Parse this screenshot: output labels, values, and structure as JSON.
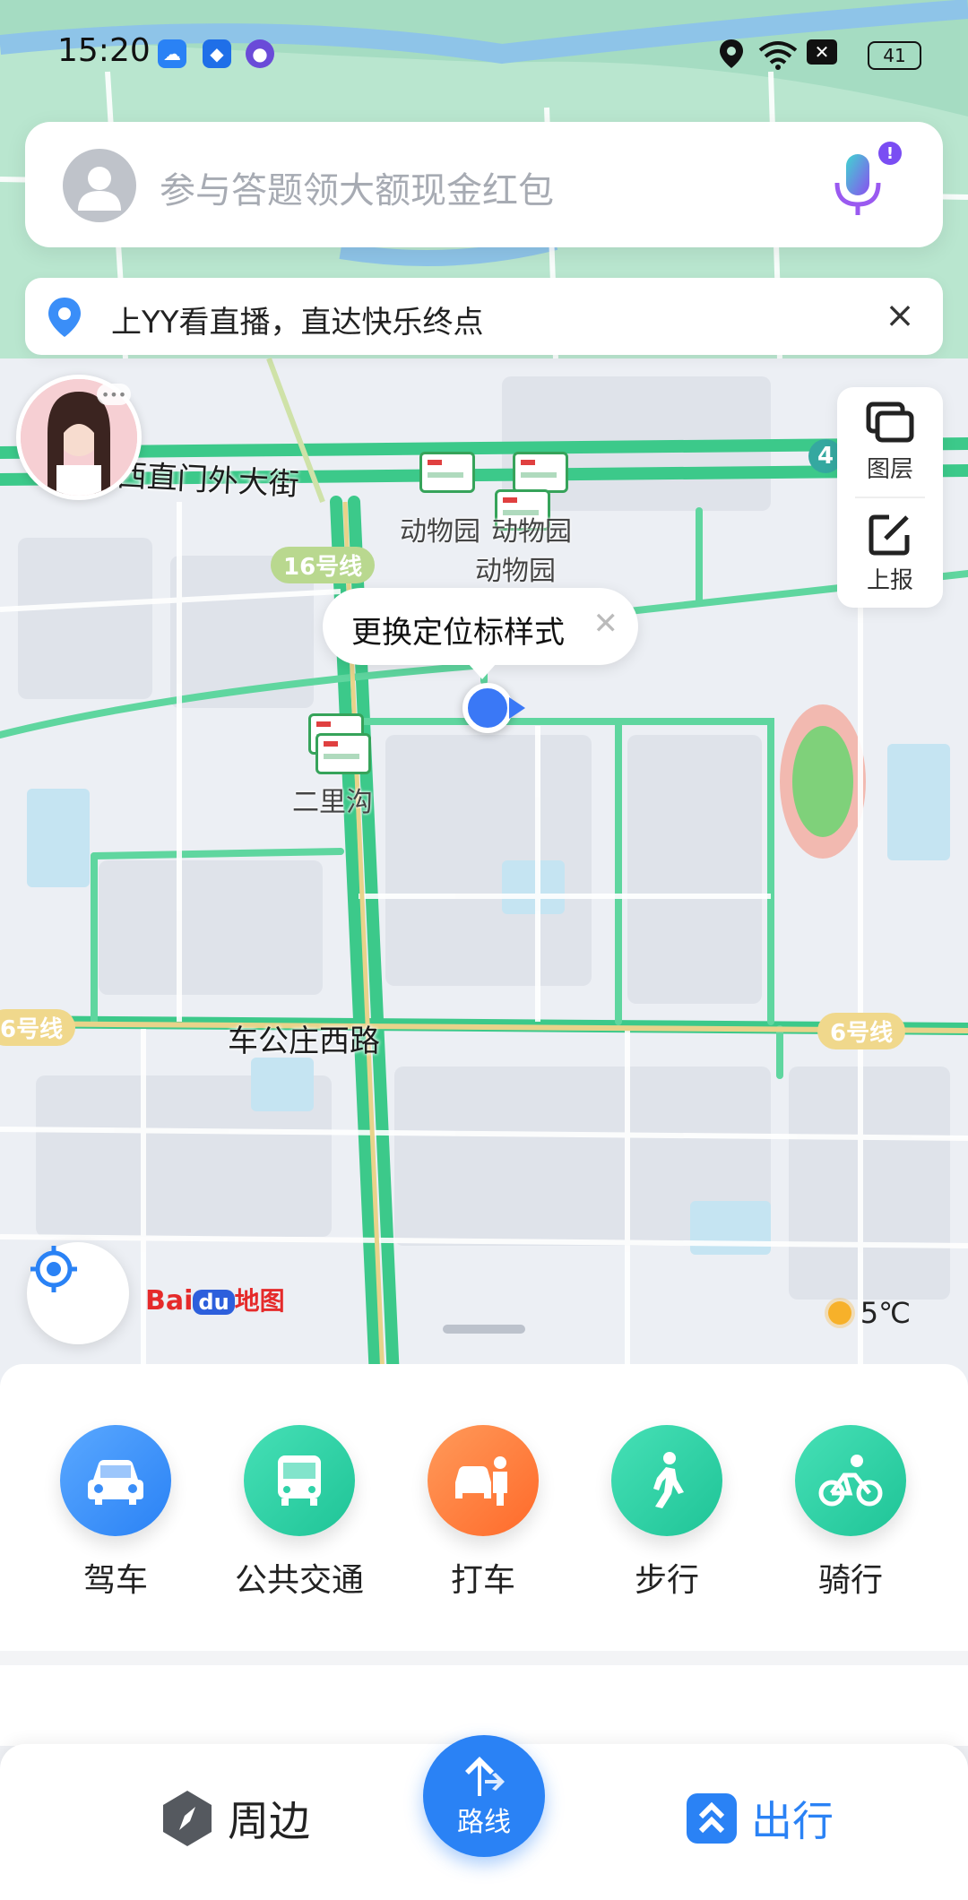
{
  "status_bar": {
    "time": "15:20",
    "battery": "41",
    "icons": [
      "cloud-icon",
      "shield-icon",
      "orb-icon",
      "location-icon",
      "wifi-icon",
      "sim-off-icon"
    ]
  },
  "search": {
    "placeholder": "参与答题领大额现金红包",
    "mic_badge": "!"
  },
  "promo": {
    "text": "上YY看直播，直达快乐终点"
  },
  "side_panel": {
    "layers_label": "图层",
    "report_label": "上报"
  },
  "map": {
    "roads": {
      "xizhimen": "西直门外大街",
      "chegongzhuang": "车公庄西路"
    },
    "pois": {
      "zoo1": "动物园",
      "zoo2": "动物园",
      "zoo3": "动物园",
      "erligou": "二里沟"
    },
    "line_badges": {
      "line16": "16号线",
      "line6_left": "6号线",
      "line6_right": "6号线",
      "line4": "4"
    },
    "tooltip": "更换定位标样式",
    "more_dots": "•••",
    "weather": "5℃",
    "logo": {
      "bai": "Bai",
      "du": "du",
      "map": "地图"
    }
  },
  "modes": [
    {
      "label": "驾车",
      "color": "#3a8ef8"
    },
    {
      "label": "公共交通",
      "color": "#2fd2a8"
    },
    {
      "label": "打车",
      "color": "#ff7a38"
    },
    {
      "label": "步行",
      "color": "#2fd2a8"
    },
    {
      "label": "骑行",
      "color": "#2fd2a8"
    }
  ],
  "bottom_nav": {
    "nearby": "周边",
    "route": "路线",
    "travel": "出行"
  }
}
